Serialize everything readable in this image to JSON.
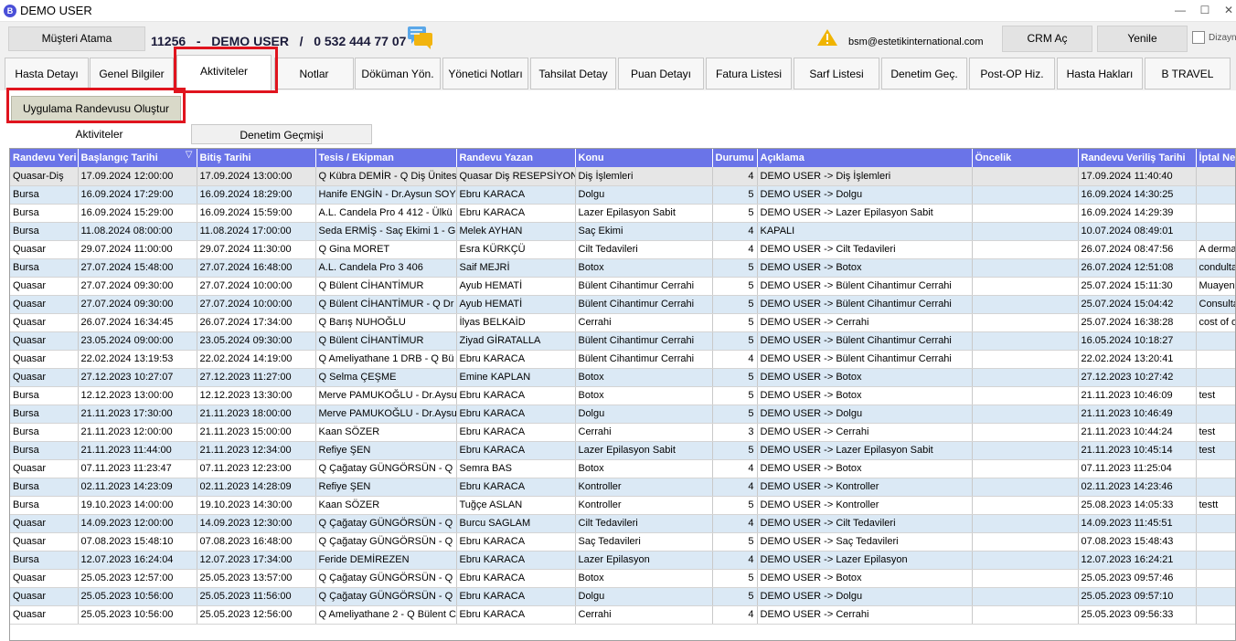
{
  "window": {
    "title": "DEMO USER",
    "app_icon": "B",
    "minimize": "—",
    "maximize": "☐"
  },
  "header": {
    "musteri_atama": "Müşteri Atama",
    "customer_id": "11256",
    "sep1": "-",
    "customer_name": "DEMO USER",
    "sep2": "/",
    "phone": "0 532 444 77 07",
    "email": "bsm@estetikinternational.com",
    "crm_ac": "CRM Aç",
    "yenile": "Yenile",
    "dizayn_label": "Dizayn"
  },
  "tabs": [
    "Hasta Detayı",
    "Genel Bilgiler",
    "Aktiviteler",
    "Notlar",
    "Döküman Yön.",
    "Yönetici Notları",
    "Tahsilat Detay",
    "Puan Detayı",
    "Fatura Listesi",
    "Sarf Listesi",
    "Denetim Geç.",
    "Post-OP Hiz.",
    "Hasta Hakları",
    "B TRAVEL"
  ],
  "active_tab": "Aktiviteler",
  "action_button": "Uygulama Randevusu Oluştur",
  "subtabs": [
    "Aktiviteler",
    "Denetim Geçmişi"
  ],
  "sort_indicator": "▽",
  "columns": [
    "Randevu Yeri",
    "Başlangıç Tarihi",
    "Bitiş Tarihi",
    "Tesis / Ekipman",
    "Randevu Yazan",
    "Konu",
    "Durumu",
    "Açıklama",
    "Öncelik",
    "Randevu Veriliş Tarihi",
    "İptal Ne"
  ],
  "rows": [
    [
      "Quasar-Diş",
      "17.09.2024 12:00:00",
      "17.09.2024 13:00:00",
      "Q Kübra DEMİR - Q Diş Ünitesi",
      "Quasar Diş RESEPSİYON",
      "Diş İşlemleri",
      "4",
      "DEMO USER -> Diş İşlemleri",
      "",
      "17.09.2024 11:40:40",
      ""
    ],
    [
      "Bursa",
      "16.09.2024 17:29:00",
      "16.09.2024 18:29:00",
      "Hanife ENGİN - Dr.Aysun SOYLU",
      "Ebru KARACA",
      "Dolgu",
      "5",
      "DEMO USER -> Dolgu",
      "",
      "16.09.2024 14:30:25",
      ""
    ],
    [
      "Bursa",
      "16.09.2024 15:29:00",
      "16.09.2024 15:59:00",
      "A.L. Candela Pro 4 412 - Ülkü",
      "Ebru KARACA",
      "Lazer Epilasyon Sabit",
      "5",
      "DEMO USER -> Lazer Epilasyon Sabit",
      "",
      "16.09.2024 14:29:39",
      ""
    ],
    [
      "Bursa",
      "11.08.2024 08:00:00",
      "11.08.2024 17:00:00",
      "Seda ERMİŞ - Saç Ekimi 1 - G",
      "Melek AYHAN",
      "Saç Ekimi",
      "4",
      "KAPALI",
      "",
      "10.07.2024 08:49:01",
      ""
    ],
    [
      "Quasar",
      "29.07.2024 11:00:00",
      "29.07.2024 11:30:00",
      "Q Gina MORET",
      "Esra KÜRKÇÜ",
      "Cilt Tedavileri",
      "4",
      "DEMO USER -> Cilt Tedavileri",
      "",
      "26.07.2024 08:47:56",
      "A dermatolog"
    ],
    [
      "Bursa",
      "27.07.2024 15:48:00",
      "27.07.2024 16:48:00",
      "A.L. Candela Pro 3 406",
      "Saif MEJRİ",
      "Botox",
      "5",
      "DEMO USER -> Botox",
      "",
      "26.07.2024 12:51:08",
      "condultation"
    ],
    [
      "Quasar",
      "27.07.2024 09:30:00",
      "27.07.2024 10:00:00",
      "Q Bülent CİHANTİMUR",
      "Ayub HEMATİ",
      "Bülent Cihantimur Cerrahi",
      "5",
      "DEMO USER -> Bülent Cihantimur Cerrahi",
      "",
      "25.07.2024 15:11:30",
      "Muayene"
    ],
    [
      "Quasar",
      "27.07.2024 09:30:00",
      "27.07.2024 10:00:00",
      "Q Bülent CİHANTİMUR - Q Dr",
      "Ayub HEMATİ",
      "Bülent Cihantimur Cerrahi",
      "5",
      "DEMO USER -> Bülent Cihantimur Cerrahi",
      "",
      "25.07.2024 15:04:42",
      "Consultation"
    ],
    [
      "Quasar",
      "26.07.2024 16:34:45",
      "26.07.2024 17:34:00",
      "Q Barış NUHOĞLU",
      "İlyas BELKAİD",
      "Cerrahi",
      "5",
      "DEMO USER -> Cerrahi",
      "",
      "25.07.2024 16:38:28",
      "cost of oper"
    ],
    [
      "Quasar",
      "23.05.2024 09:00:00",
      "23.05.2024 09:30:00",
      "Q Bülent CİHANTİMUR",
      "Ziyad GİRATALLA",
      "Bülent Cihantimur Cerrahi",
      "5",
      "DEMO USER -> Bülent Cihantimur Cerrahi",
      "",
      "16.05.2024 10:18:27",
      ""
    ],
    [
      "Quasar",
      "22.02.2024 13:19:53",
      "22.02.2024 14:19:00",
      "Q Ameliyathane 1 DRB - Q Bü",
      "Ebru KARACA",
      "Bülent Cihantimur Cerrahi",
      "4",
      "DEMO USER -> Bülent Cihantimur Cerrahi",
      "",
      "22.02.2024 13:20:41",
      ""
    ],
    [
      "Quasar",
      "27.12.2023 10:27:07",
      "27.12.2023 11:27:00",
      "Q Selma ÇEŞME",
      "Emine KAPLAN",
      "Botox",
      "5",
      "DEMO USER -> Botox",
      "",
      "27.12.2023 10:27:42",
      ""
    ],
    [
      "Bursa",
      "12.12.2023 13:00:00",
      "12.12.2023 13:30:00",
      "Merve PAMUKOĞLU - Dr.Aysun",
      "Ebru KARACA",
      "Botox",
      "5",
      "DEMO USER -> Botox",
      "",
      "21.11.2023 10:46:09",
      "test"
    ],
    [
      "Bursa",
      "21.11.2023 17:30:00",
      "21.11.2023 18:00:00",
      "Merve PAMUKOĞLU - Dr.Aysun",
      "Ebru KARACA",
      "Dolgu",
      "5",
      "DEMO USER -> Dolgu",
      "",
      "21.11.2023 10:46:49",
      ""
    ],
    [
      "Bursa",
      "21.11.2023 12:00:00",
      "21.11.2023 15:00:00",
      "Kaan SÖZER",
      "Ebru KARACA",
      "Cerrahi",
      "3",
      "DEMO USER -> Cerrahi",
      "",
      "21.11.2023 10:44:24",
      "test"
    ],
    [
      "Bursa",
      "21.11.2023 11:44:00",
      "21.11.2023 12:34:00",
      "Refiye ŞEN",
      "Ebru KARACA",
      "Lazer Epilasyon Sabit",
      "5",
      "DEMO USER -> Lazer Epilasyon Sabit",
      "",
      "21.11.2023 10:45:14",
      "test"
    ],
    [
      "Quasar",
      "07.11.2023 11:23:47",
      "07.11.2023 12:23:00",
      "Q Çağatay GÜNGÖRSÜN - Q",
      "Semra BAS",
      "Botox",
      "4",
      "DEMO USER -> Botox",
      "",
      "07.11.2023 11:25:04",
      ""
    ],
    [
      "Bursa",
      "02.11.2023 14:23:09",
      "02.11.2023 14:28:09",
      "Refiye ŞEN",
      "Ebru KARACA",
      "Kontroller",
      "4",
      "DEMO USER -> Kontroller",
      "",
      "02.11.2023 14:23:46",
      ""
    ],
    [
      "Bursa",
      "19.10.2023 14:00:00",
      "19.10.2023 14:30:00",
      "Kaan SÖZER",
      "Tuğçe ASLAN",
      "Kontroller",
      "5",
      "DEMO USER -> Kontroller",
      "",
      "25.08.2023 14:05:33",
      "testt"
    ],
    [
      "Quasar",
      "14.09.2023 12:00:00",
      "14.09.2023 12:30:00",
      "Q Çağatay GÜNGÖRSÜN - Q",
      "Burcu SAGLAM",
      "Cilt Tedavileri",
      "4",
      "DEMO USER -> Cilt Tedavileri",
      "",
      "14.09.2023 11:45:51",
      ""
    ],
    [
      "Quasar",
      "07.08.2023 15:48:10",
      "07.08.2023 16:48:00",
      "Q Çağatay GÜNGÖRSÜN - Q",
      "Ebru KARACA",
      "Saç Tedavileri",
      "5",
      "DEMO USER -> Saç Tedavileri",
      "",
      "07.08.2023 15:48:43",
      ""
    ],
    [
      "Bursa",
      "12.07.2023 16:24:04",
      "12.07.2023 17:34:00",
      "Feride DEMİREZEN",
      "Ebru KARACA",
      "Lazer Epilasyon",
      "4",
      "DEMO USER -> Lazer Epilasyon",
      "",
      "12.07.2023 16:24:21",
      ""
    ],
    [
      "Quasar",
      "25.05.2023 12:57:00",
      "25.05.2023 13:57:00",
      "Q Çağatay GÜNGÖRSÜN - Q",
      "Ebru KARACA",
      "Botox",
      "5",
      "DEMO USER -> Botox",
      "",
      "25.05.2023 09:57:46",
      ""
    ],
    [
      "Quasar",
      "25.05.2023 10:56:00",
      "25.05.2023 11:56:00",
      "Q Çağatay GÜNGÖRSÜN - Q",
      "Ebru KARACA",
      "Dolgu",
      "5",
      "DEMO USER -> Dolgu",
      "",
      "25.05.2023 09:57:10",
      ""
    ],
    [
      "Quasar",
      "25.05.2023 10:56:00",
      "25.05.2023 12:56:00",
      "Q Ameliyathane 2 - Q Bülent C",
      "Ebru KARACA",
      "Cerrahi",
      "4",
      "DEMO USER -> Cerrahi",
      "",
      "25.05.2023 09:56:33",
      ""
    ]
  ],
  "colors": {
    "header_bg": "#6a74e8",
    "row_alt": "#dbe9f5",
    "highlight": "#e0141e",
    "action_btn": "#d9d9c9"
  }
}
